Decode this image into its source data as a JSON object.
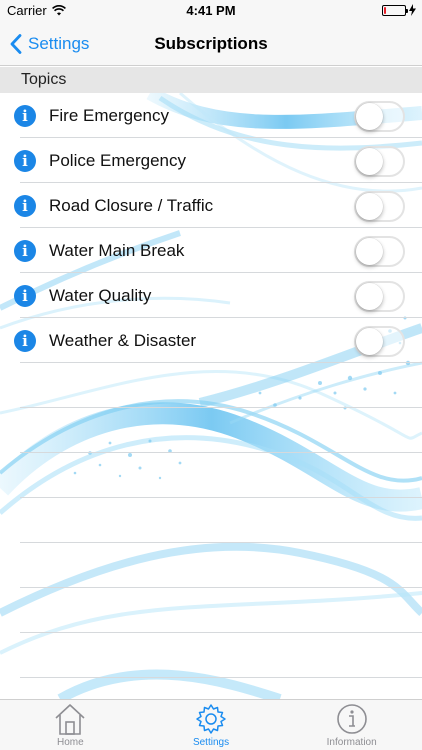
{
  "status_bar": {
    "carrier": "Carrier",
    "time": "4:41 PM",
    "battery_level": 0.1
  },
  "nav": {
    "back_label": "Settings",
    "title": "Subscriptions"
  },
  "section": {
    "header": "Topics"
  },
  "topics": [
    {
      "label": "Fire Emergency",
      "enabled": false
    },
    {
      "label": "Police Emergency",
      "enabled": false
    },
    {
      "label": "Road Closure / Traffic",
      "enabled": false
    },
    {
      "label": "Water Main Break",
      "enabled": false
    },
    {
      "label": "Water Quality",
      "enabled": false
    },
    {
      "label": "Weather & Disaster",
      "enabled": false
    }
  ],
  "tabs": [
    {
      "label": "Home",
      "icon": "house-icon",
      "active": false
    },
    {
      "label": "Settings",
      "icon": "gear-icon",
      "active": true
    },
    {
      "label": "Information",
      "icon": "info-circle-icon",
      "active": false
    }
  ],
  "colors": {
    "accent": "#1a8cf0",
    "info_icon": "#1b86e6",
    "tab_inactive": "#8e8e93"
  }
}
